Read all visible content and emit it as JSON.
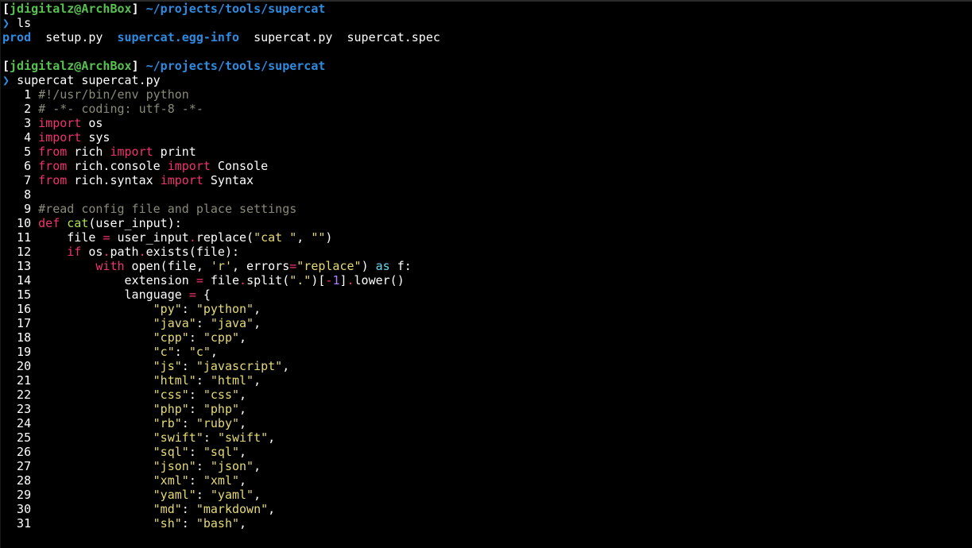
{
  "prompt": {
    "user_host": "jdigitalz@ArchBox",
    "path": "~/projects/tools/supercat",
    "symbol": "❯"
  },
  "commands": [
    "ls",
    "supercat supercat.py"
  ],
  "ls_output": [
    {
      "name": "prod",
      "kind": "dir"
    },
    {
      "name": "setup.py",
      "kind": "file"
    },
    {
      "name": "supercat.egg-info",
      "kind": "dir"
    },
    {
      "name": "supercat.py",
      "kind": "file"
    },
    {
      "name": "supercat.spec",
      "kind": "file"
    }
  ],
  "code": [
    {
      "n": "1",
      "t": [
        [
          "c",
          "#!/usr/bin/env python"
        ]
      ]
    },
    {
      "n": "2",
      "t": [
        [
          "c",
          "# -*- coding: utf-8 -*-"
        ]
      ]
    },
    {
      "n": "3",
      "t": [
        [
          "k",
          "import"
        ],
        [
          "d",
          " os"
        ]
      ]
    },
    {
      "n": "4",
      "t": [
        [
          "k",
          "import"
        ],
        [
          "d",
          " sys"
        ]
      ]
    },
    {
      "n": "5",
      "t": [
        [
          "k",
          "from"
        ],
        [
          "d",
          " rich "
        ],
        [
          "k",
          "import"
        ],
        [
          "d",
          " print"
        ]
      ]
    },
    {
      "n": "6",
      "t": [
        [
          "k",
          "from"
        ],
        [
          "d",
          " rich.console "
        ],
        [
          "k",
          "import"
        ],
        [
          "d",
          " Console"
        ]
      ]
    },
    {
      "n": "7",
      "t": [
        [
          "k",
          "from"
        ],
        [
          "d",
          " rich.syntax "
        ],
        [
          "k",
          "import"
        ],
        [
          "d",
          " Syntax"
        ]
      ]
    },
    {
      "n": "8",
      "t": []
    },
    {
      "n": "9",
      "t": [
        [
          "c",
          "#read config file and place settings"
        ]
      ]
    },
    {
      "n": "10",
      "t": [
        [
          "k",
          "def"
        ],
        [
          "d",
          " "
        ],
        [
          "f",
          "cat"
        ],
        [
          "d",
          "(user_input):"
        ]
      ]
    },
    {
      "n": "11",
      "t": [
        [
          "d",
          "    file "
        ],
        [
          "o",
          "="
        ],
        [
          "d",
          " user_input"
        ],
        [
          "o",
          "."
        ],
        [
          "d",
          "replace("
        ],
        [
          "s",
          "\"cat \""
        ],
        [
          "d",
          ", "
        ],
        [
          "s",
          "\"\""
        ],
        [
          "d",
          ")"
        ]
      ]
    },
    {
      "n": "12",
      "t": [
        [
          "d",
          "    "
        ],
        [
          "k",
          "if"
        ],
        [
          "d",
          " os"
        ],
        [
          "o",
          "."
        ],
        [
          "d",
          "path"
        ],
        [
          "o",
          "."
        ],
        [
          "d",
          "exists(file):"
        ]
      ]
    },
    {
      "n": "13",
      "t": [
        [
          "d",
          "        "
        ],
        [
          "k",
          "with"
        ],
        [
          "d",
          " open(file, "
        ],
        [
          "s",
          "'r'"
        ],
        [
          "d",
          ", errors"
        ],
        [
          "o",
          "="
        ],
        [
          "s",
          "\"replace\""
        ],
        [
          "d",
          ") "
        ],
        [
          "a",
          "as"
        ],
        [
          "d",
          " f:"
        ]
      ]
    },
    {
      "n": "14",
      "t": [
        [
          "d",
          "            extension "
        ],
        [
          "o",
          "="
        ],
        [
          "d",
          " file"
        ],
        [
          "o",
          "."
        ],
        [
          "d",
          "split("
        ],
        [
          "s",
          "\".\""
        ],
        [
          "d",
          ")["
        ],
        [
          "o",
          "-"
        ],
        [
          "m",
          "1"
        ],
        [
          "d",
          "]"
        ],
        [
          "o",
          "."
        ],
        [
          "d",
          "lower()"
        ]
      ]
    },
    {
      "n": "15",
      "t": [
        [
          "d",
          "            language "
        ],
        [
          "o",
          "="
        ],
        [
          "d",
          " {"
        ]
      ]
    },
    {
      "n": "16",
      "t": [
        [
          "d",
          "                "
        ],
        [
          "s",
          "\"py\""
        ],
        [
          "d",
          ": "
        ],
        [
          "s",
          "\"python\""
        ],
        [
          "d",
          ","
        ]
      ]
    },
    {
      "n": "17",
      "t": [
        [
          "d",
          "                "
        ],
        [
          "s",
          "\"java\""
        ],
        [
          "d",
          ": "
        ],
        [
          "s",
          "\"java\""
        ],
        [
          "d",
          ","
        ]
      ]
    },
    {
      "n": "18",
      "t": [
        [
          "d",
          "                "
        ],
        [
          "s",
          "\"cpp\""
        ],
        [
          "d",
          ": "
        ],
        [
          "s",
          "\"cpp\""
        ],
        [
          "d",
          ","
        ]
      ]
    },
    {
      "n": "19",
      "t": [
        [
          "d",
          "                "
        ],
        [
          "s",
          "\"c\""
        ],
        [
          "d",
          ": "
        ],
        [
          "s",
          "\"c\""
        ],
        [
          "d",
          ","
        ]
      ]
    },
    {
      "n": "20",
      "t": [
        [
          "d",
          "                "
        ],
        [
          "s",
          "\"js\""
        ],
        [
          "d",
          ": "
        ],
        [
          "s",
          "\"javascript\""
        ],
        [
          "d",
          ","
        ]
      ]
    },
    {
      "n": "21",
      "t": [
        [
          "d",
          "                "
        ],
        [
          "s",
          "\"html\""
        ],
        [
          "d",
          ": "
        ],
        [
          "s",
          "\"html\""
        ],
        [
          "d",
          ","
        ]
      ]
    },
    {
      "n": "22",
      "t": [
        [
          "d",
          "                "
        ],
        [
          "s",
          "\"css\""
        ],
        [
          "d",
          ": "
        ],
        [
          "s",
          "\"css\""
        ],
        [
          "d",
          ","
        ]
      ]
    },
    {
      "n": "23",
      "t": [
        [
          "d",
          "                "
        ],
        [
          "s",
          "\"php\""
        ],
        [
          "d",
          ": "
        ],
        [
          "s",
          "\"php\""
        ],
        [
          "d",
          ","
        ]
      ]
    },
    {
      "n": "24",
      "t": [
        [
          "d",
          "                "
        ],
        [
          "s",
          "\"rb\""
        ],
        [
          "d",
          ": "
        ],
        [
          "s",
          "\"ruby\""
        ],
        [
          "d",
          ","
        ]
      ]
    },
    {
      "n": "25",
      "t": [
        [
          "d",
          "                "
        ],
        [
          "s",
          "\"swift\""
        ],
        [
          "d",
          ": "
        ],
        [
          "s",
          "\"swift\""
        ],
        [
          "d",
          ","
        ]
      ]
    },
    {
      "n": "26",
      "t": [
        [
          "d",
          "                "
        ],
        [
          "s",
          "\"sql\""
        ],
        [
          "d",
          ": "
        ],
        [
          "s",
          "\"sql\""
        ],
        [
          "d",
          ","
        ]
      ]
    },
    {
      "n": "27",
      "t": [
        [
          "d",
          "                "
        ],
        [
          "s",
          "\"json\""
        ],
        [
          "d",
          ": "
        ],
        [
          "s",
          "\"json\""
        ],
        [
          "d",
          ","
        ]
      ]
    },
    {
      "n": "28",
      "t": [
        [
          "d",
          "                "
        ],
        [
          "s",
          "\"xml\""
        ],
        [
          "d",
          ": "
        ],
        [
          "s",
          "\"xml\""
        ],
        [
          "d",
          ","
        ]
      ]
    },
    {
      "n": "29",
      "t": [
        [
          "d",
          "                "
        ],
        [
          "s",
          "\"yaml\""
        ],
        [
          "d",
          ": "
        ],
        [
          "s",
          "\"yaml\""
        ],
        [
          "d",
          ","
        ]
      ]
    },
    {
      "n": "30",
      "t": [
        [
          "d",
          "                "
        ],
        [
          "s",
          "\"md\""
        ],
        [
          "d",
          ": "
        ],
        [
          "s",
          "\"markdown\""
        ],
        [
          "d",
          ","
        ]
      ]
    },
    {
      "n": "31",
      "t": [
        [
          "d",
          "                "
        ],
        [
          "s",
          "\"sh\""
        ],
        [
          "d",
          ": "
        ],
        [
          "s",
          "\"bash\""
        ],
        [
          "d",
          ","
        ]
      ]
    }
  ],
  "colors": {
    "background": "#000000",
    "prompt_user": "#57c150",
    "prompt_path": "#2f8be0",
    "keyword": "#f0326e",
    "function": "#a9e250",
    "string": "#e6db74",
    "comment": "#8a8a78",
    "number": "#ae81ff",
    "builtin_as": "#66d9ef"
  }
}
